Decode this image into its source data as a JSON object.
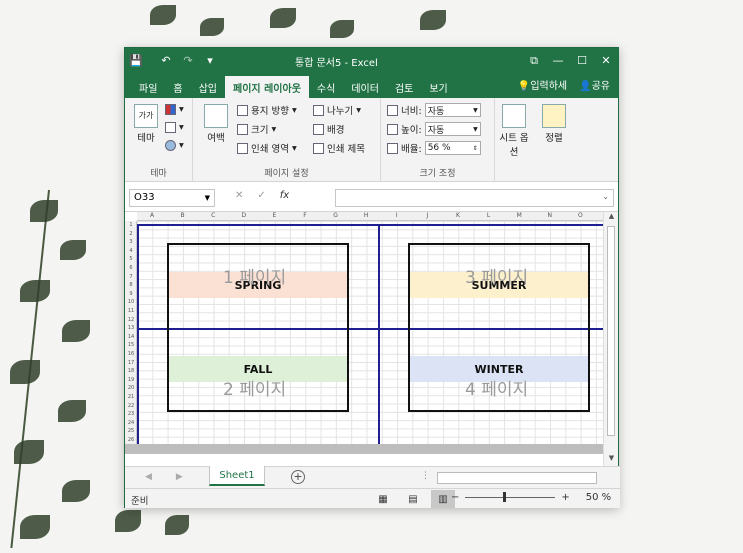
{
  "window": {
    "title": "통합 문서5 - Excel",
    "controls": {
      "restore": "⧉",
      "minimize": "—",
      "maximize": "☐",
      "close": "✕"
    }
  },
  "quick_access": {
    "save": "💾",
    "undo": "↶",
    "redo": "↷",
    "customize": "▾"
  },
  "menu": {
    "items": [
      "파일",
      "홈",
      "삽입",
      "페이지 레이아웃",
      "수식",
      "데이터",
      "검토",
      "보기"
    ],
    "active": "페이지 레이아웃",
    "tell_me": "입력하세",
    "share": "공유"
  },
  "ribbon": {
    "theme_group": {
      "label": "테마",
      "theme_btn": "테마",
      "theme_icon_text": "가가"
    },
    "page_setup_group": {
      "label": "페이지 설정",
      "margins": "여백",
      "orientation": "용지 방향",
      "size": "크기",
      "print_area": "인쇄 영역",
      "breaks": "나누기",
      "background": "배경",
      "print_titles": "인쇄 제목"
    },
    "scale_group": {
      "label": "크기 조정",
      "width_label": "너비:",
      "width_value": "자동",
      "height_label": "높이:",
      "height_value": "자동",
      "scale_label": "배율:",
      "scale_value": "56 %"
    },
    "sheet_options": {
      "label_line1": "시트 옵",
      "label_line2": "션"
    },
    "arrange": {
      "label": "정렬"
    }
  },
  "formula_bar": {
    "name_box": "O33",
    "cancel": "✕",
    "enter": "✓",
    "fx": "fx",
    "value": ""
  },
  "columns": [
    "A",
    "B",
    "C",
    "D",
    "E",
    "F",
    "G",
    "H",
    "I",
    "J",
    "K",
    "L",
    "M",
    "N",
    "O"
  ],
  "rows": [
    "1",
    "2",
    "3",
    "4",
    "5",
    "6",
    "7",
    "8",
    "9",
    "10",
    "11",
    "12",
    "13",
    "14",
    "15",
    "16",
    "17",
    "18",
    "19",
    "20",
    "21",
    "22",
    "23",
    "24",
    "25",
    "26"
  ],
  "pages": [
    {
      "watermark": "1 페이지",
      "label": "SPRING",
      "color": "#fbe0d4"
    },
    {
      "watermark": "3 페이지",
      "label": "SUMMER",
      "color": "#fdf0cc"
    },
    {
      "watermark": "2 페이지",
      "label": "FALL",
      "color": "#dff0d8"
    },
    {
      "watermark": "4 페이지",
      "label": "WINTER",
      "color": "#dbe3f4"
    }
  ],
  "tabs": {
    "sheet1": "Sheet1",
    "add": "+"
  },
  "status": {
    "ready": "준비",
    "zoom": "50 %",
    "zoom_minus": "−",
    "zoom_plus": "+"
  },
  "colors": {
    "excel_green": "#217346",
    "page_break": "#1f1f8f"
  }
}
